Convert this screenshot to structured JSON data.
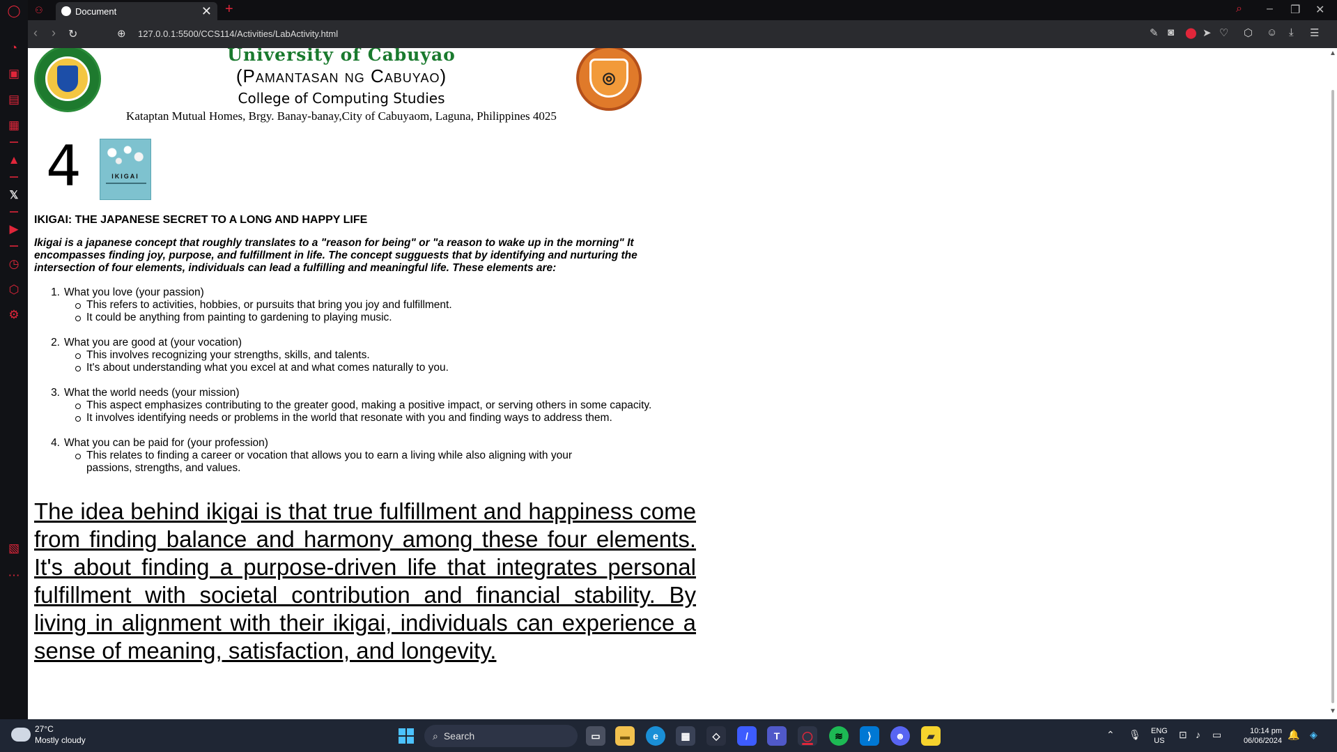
{
  "browser": {
    "tab_title": "Document",
    "url": "127.0.0.1:5500/CCS114/Activities/LabActivity.html",
    "new_tab_symbol": "+",
    "tab_close_symbol": "✕"
  },
  "sidebar": {
    "icons": [
      "speed-dial-icon",
      "shopping-bag-icon",
      "twitch-icon",
      "crypto-wallet-icon",
      "aria-icon",
      "x-twitter-icon",
      "player-icon",
      "history-icon",
      "extensions-icon",
      "settings-icon",
      "pinboard-icon",
      "more-icon"
    ],
    "x_label": "𝕏",
    "more_label": "⋯"
  },
  "header": {
    "university": "University of Cabuyao",
    "university_sub": "(Pamantasan ng Cabuyao)",
    "college": "College of Computing Studies",
    "address": "Kataptan Mutual Homes, Brgy. Banay-banay,City of Cabuyaom, Laguna, Philippines 4025"
  },
  "content": {
    "number": "4",
    "book_title": "IKIGAI",
    "section_title": "IKIGAI: THE JAPANESE SECRET TO A LONG AND HAPPY LIFE",
    "intro": "Ikigai is a japanese concept that roughly translates to a \"reason for being\" or \"a reason to wake up in the morning\" It encompasses finding joy, purpose, and fulfillment in life. The concept sugguests that by identifying and nurturing the intersection of four elements, individuals can lead a fulfilling and meaningful life. These elements are:",
    "elements": [
      {
        "num": "1.",
        "title": "What you love (your passion)",
        "points": [
          "This refers to activities, hobbies, or pursuits that bring you joy and fulfillment.",
          "It could be anything from painting to gardening to playing music."
        ]
      },
      {
        "num": "2.",
        "title": "What you are good at (your vocation)",
        "points": [
          "This involves recognizing your strengths, skills, and talents.",
          "It's about understanding what you excel at and what comes naturally to you."
        ]
      },
      {
        "num": "3.",
        "title": "What the world needs (your mission)",
        "points": [
          "This aspect emphasizes contributing to the greater good, making a positive impact, or serving others in some capacity.",
          "It involves identifying needs or problems in the world that resonate with you and finding ways to address them."
        ]
      },
      {
        "num": "4.",
        "title": "What you can be paid for (your profession)",
        "points": [
          "This relates to finding a career or vocation that allows you to earn a living while also aligning with your passions, strengths, and values."
        ]
      }
    ],
    "closing": "The idea behind ikigai is that true fulfillment and happiness come from finding balance and harmony among these four elements. It's about finding a purpose-driven life that integrates personal fulfillment with societal contribution and financial stability. By living in alignment with their ikigai, individuals can experience a sense of meaning, satisfaction, and longevity."
  },
  "taskbar": {
    "temperature": "27°C",
    "weather": "Mostly cloudy",
    "search_placeholder": "Search",
    "lang_top": "ENG",
    "lang_bottom": "US",
    "time": "10:14 pm",
    "date": "06/06/2024"
  },
  "colors": {
    "opera_red": "#e0263a",
    "university_green": "#1a7a2e",
    "taskbar_bg": "#1f2634"
  }
}
